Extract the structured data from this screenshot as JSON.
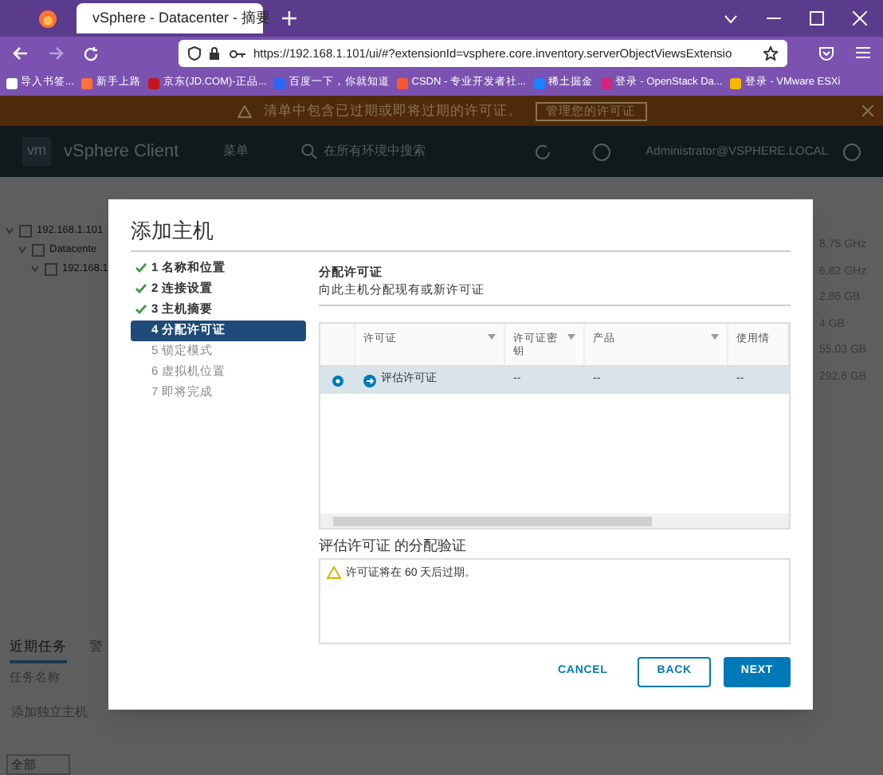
{
  "browser": {
    "tab_title": "vSphere - Datacenter - 摘要",
    "url": "https://192.168.1.101/ui/#?extensionId=vsphere.core.inventory.serverObjectViewsExtensio",
    "bookmarks": [
      "导入书签...",
      "新手上路",
      "京东(JD.COM)-正品...",
      "百度一下，你就知道",
      "CSDN - 专业开发者社...",
      "稀土掘金",
      "登录 - OpenStack Da...",
      "登录 - VMware ESXi"
    ]
  },
  "banner": {
    "message": "清单中包含已过期或即将过期的许可证。",
    "action": "管理您的许可证"
  },
  "header": {
    "logo": "vm",
    "product": "vSphere Client",
    "menu": "菜单",
    "search_placeholder": "在所有环境中搜索",
    "user": "Administrator@VSPHERE.LOCAL"
  },
  "tree": [
    {
      "label": "192.168.1.101",
      "children": [
        {
          "label": "Datacente",
          "children": [
            {
              "label": "192.168.1"
            }
          ]
        }
      ]
    }
  ],
  "right_values": [
    "8.75 GHz",
    "6.82 GHz",
    "2.86 GB",
    "4 GB",
    "55.03 GB",
    "292.6 GB"
  ],
  "bottom": {
    "tabs": [
      {
        "label": "近期任务",
        "selected": true
      },
      {
        "label": "警",
        "selected": false
      }
    ],
    "column": "任务名称",
    "task": "添加独立主机",
    "filter": "全部"
  },
  "dialog": {
    "title": "添加主机",
    "steps": [
      {
        "label": "1 名称和位置",
        "done": true,
        "selected": false
      },
      {
        "label": "2 连接设置",
        "done": true,
        "selected": false
      },
      {
        "label": "3 主机摘要",
        "done": true,
        "selected": false
      },
      {
        "label": "4 分配许可证",
        "done": false,
        "selected": true
      },
      {
        "label": "5 锁定模式",
        "done": false,
        "selected": false
      },
      {
        "label": "6 虚拟机位置",
        "done": false,
        "selected": false
      },
      {
        "label": "7 即将完成",
        "done": false,
        "selected": false
      }
    ],
    "section_title": "分配许可证",
    "section_subtitle": "向此主机分配现有或新许可证",
    "table": {
      "columns": [
        "许可证",
        "许可证密钥",
        "产品",
        "使用情"
      ],
      "rows": [
        {
          "selected": true,
          "cells": [
            "评估许可证",
            "--",
            "--",
            "--"
          ]
        }
      ]
    },
    "validation_title": "评估许可证 的分配验证",
    "validation_message": "许可证将在 60 天后过期。",
    "buttons": [
      {
        "label": "CANCEL",
        "kind": "link"
      },
      {
        "label": "BACK",
        "kind": "outline"
      },
      {
        "label": "NEXT",
        "kind": "primary"
      }
    ]
  }
}
